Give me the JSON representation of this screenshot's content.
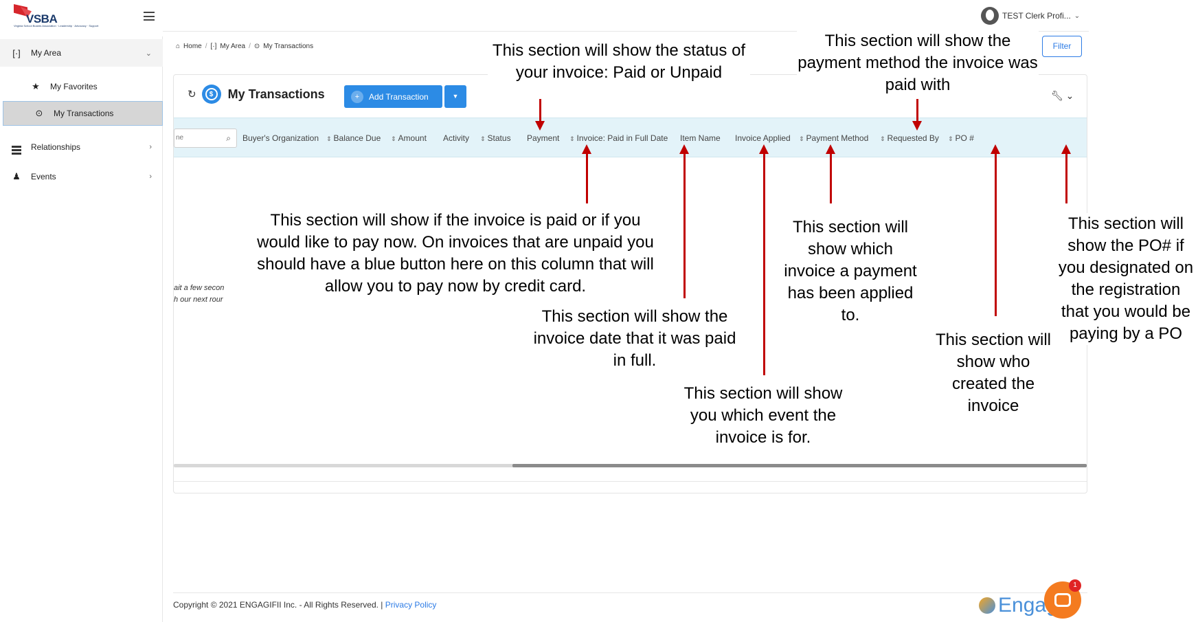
{
  "brand": {
    "logo_text": "VSBA",
    "logo_subtitle": "Virginia School Boards Association · Leadership · Advocacy · Support"
  },
  "user": {
    "name": "TEST Clerk Profi..."
  },
  "sidebar": {
    "items": [
      {
        "label": "My Area",
        "icon": "target-icon"
      },
      {
        "label": "My Favorites",
        "icon": "star-icon"
      },
      {
        "label": "My Transactions",
        "icon": "dollar-icon"
      },
      {
        "label": "Relationships",
        "icon": "bars-icon"
      },
      {
        "label": "Events",
        "icon": "person-icon"
      }
    ]
  },
  "breadcrumb": {
    "home": "Home",
    "area": "My Area",
    "current": "My Transactions"
  },
  "filter_label": "Filter",
  "card": {
    "title": "My Transactions",
    "add_label": "Add Transaction",
    "search_placeholder": "ne",
    "columns": [
      "Buyer's Organization",
      "Balance Due",
      "Amount",
      "Activity",
      "Status",
      "Payment",
      "Invoice: Paid in Full Date",
      "Item Name",
      "Invoice Applied",
      "Payment Method",
      "Requested By",
      "PO #"
    ],
    "loading_line1": "ait a few secon",
    "loading_line2": "h our next rour"
  },
  "footer": {
    "copyright": "Copyright © 2021 ENGAGIFII Inc. - All Rights Reserved. | ",
    "privacy": "Privacy Policy",
    "brand": "Engag",
    "chat_badge": "1"
  },
  "annotations": {
    "status": "This section will show the status of your invoice: Paid or Unpaid",
    "payment_method": "This section will show the payment method the invoice was paid with",
    "payment": "This section will show if the invoice is paid or if you would like to pay now. On invoices that are unpaid you should have a blue button here on this column that will allow you to pay now by credit card.",
    "invoice_applied": "This section will show which invoice a payment has been applied to.",
    "po": "This section will show the PO# if you designated on the registration that you would be paying by a PO",
    "paid_date": "This section will show the invoice date that it was paid in full.",
    "requested_by": "This section will show who created the invoice",
    "item_name": "This section will show you which event the invoice is for."
  },
  "colors": {
    "accent": "#2c8be5",
    "arrow": "#c00000",
    "header_bg": "#e3f3f9",
    "chat": "#f47b20"
  }
}
